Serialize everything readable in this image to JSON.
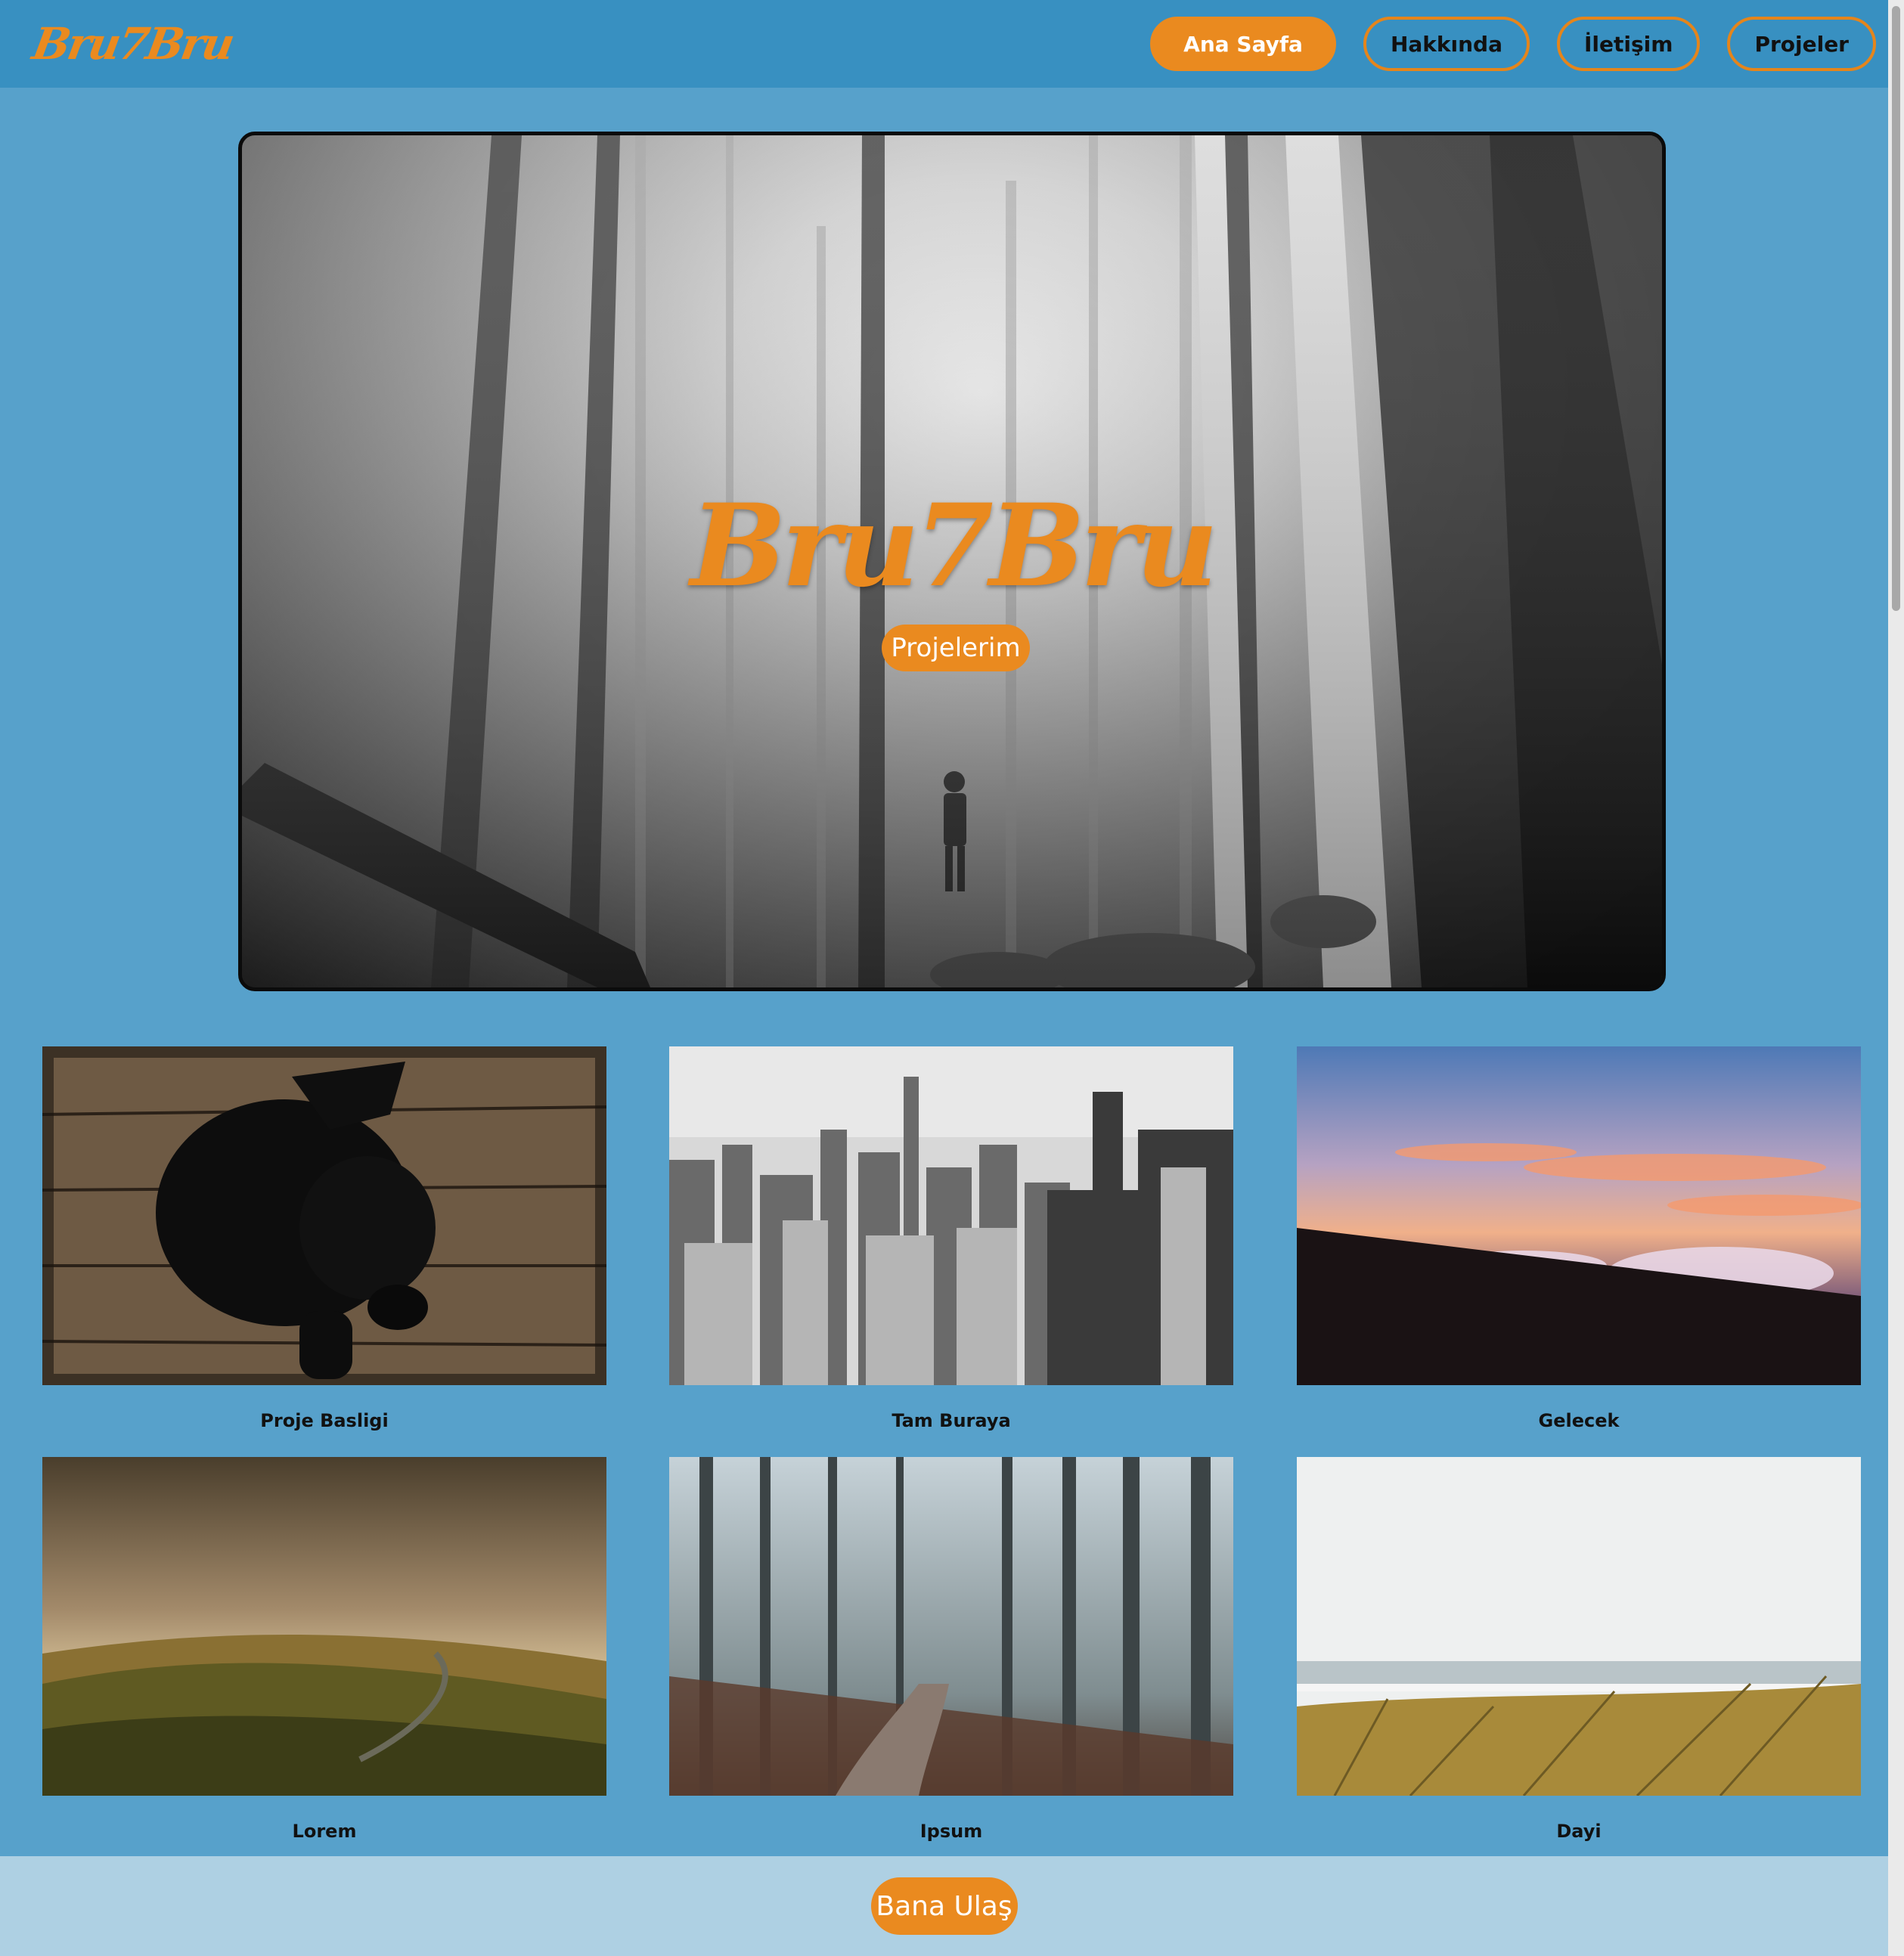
{
  "header": {
    "logo": "Bru7Bru",
    "nav": [
      {
        "label": "Ana Sayfa",
        "active": true
      },
      {
        "label": "Hakkında",
        "active": false
      },
      {
        "label": "İletişim",
        "active": false
      },
      {
        "label": "Projeler",
        "active": false
      }
    ]
  },
  "hero": {
    "title": "Bru7Bru",
    "button_label": "Projelerim"
  },
  "projects": [
    {
      "caption": "Proje Basligi",
      "image": "black-puppy-on-wood"
    },
    {
      "caption": "Tam Buraya",
      "image": "city-skyline-bw"
    },
    {
      "caption": "Gelecek",
      "image": "sunset-over-clouds"
    },
    {
      "caption": "Lorem",
      "image": "golden-hills-fog"
    },
    {
      "caption": "Ipsum",
      "image": "misty-forest-path"
    },
    {
      "caption": "Dayi",
      "image": "beach-grass"
    }
  ],
  "footer": {
    "button_label": "Bana Ulaş"
  },
  "colors": {
    "accent": "#ea8a1f",
    "header_bg": "#3890c1",
    "page_bg": "#57a1cb",
    "footer_bg": "#aed0e3"
  }
}
